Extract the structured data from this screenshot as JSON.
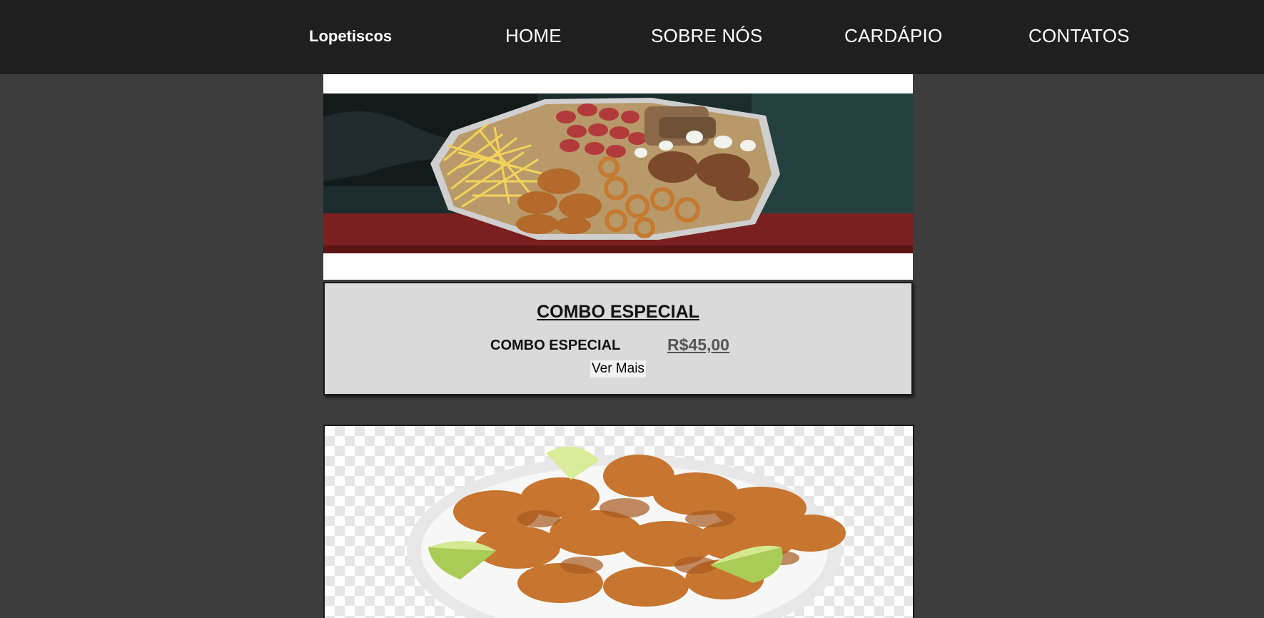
{
  "navbar": {
    "brand": "Lopetiscos",
    "items": [
      {
        "label": "HOME"
      },
      {
        "label": "SOBRE NÓS"
      },
      {
        "label": "CARDÁPIO"
      },
      {
        "label": "CONTATOS"
      }
    ]
  },
  "cards": [
    {
      "title": "COMBO ESPECIAL",
      "item_name": "COMBO ESPECIAL",
      "price": "R$45,00",
      "more_label": "Ver Mais"
    }
  ],
  "colors": {
    "navbar_bg": "#1f1f1f",
    "page_bg": "#3d3d3d",
    "card_body_bg": "#dadada"
  }
}
